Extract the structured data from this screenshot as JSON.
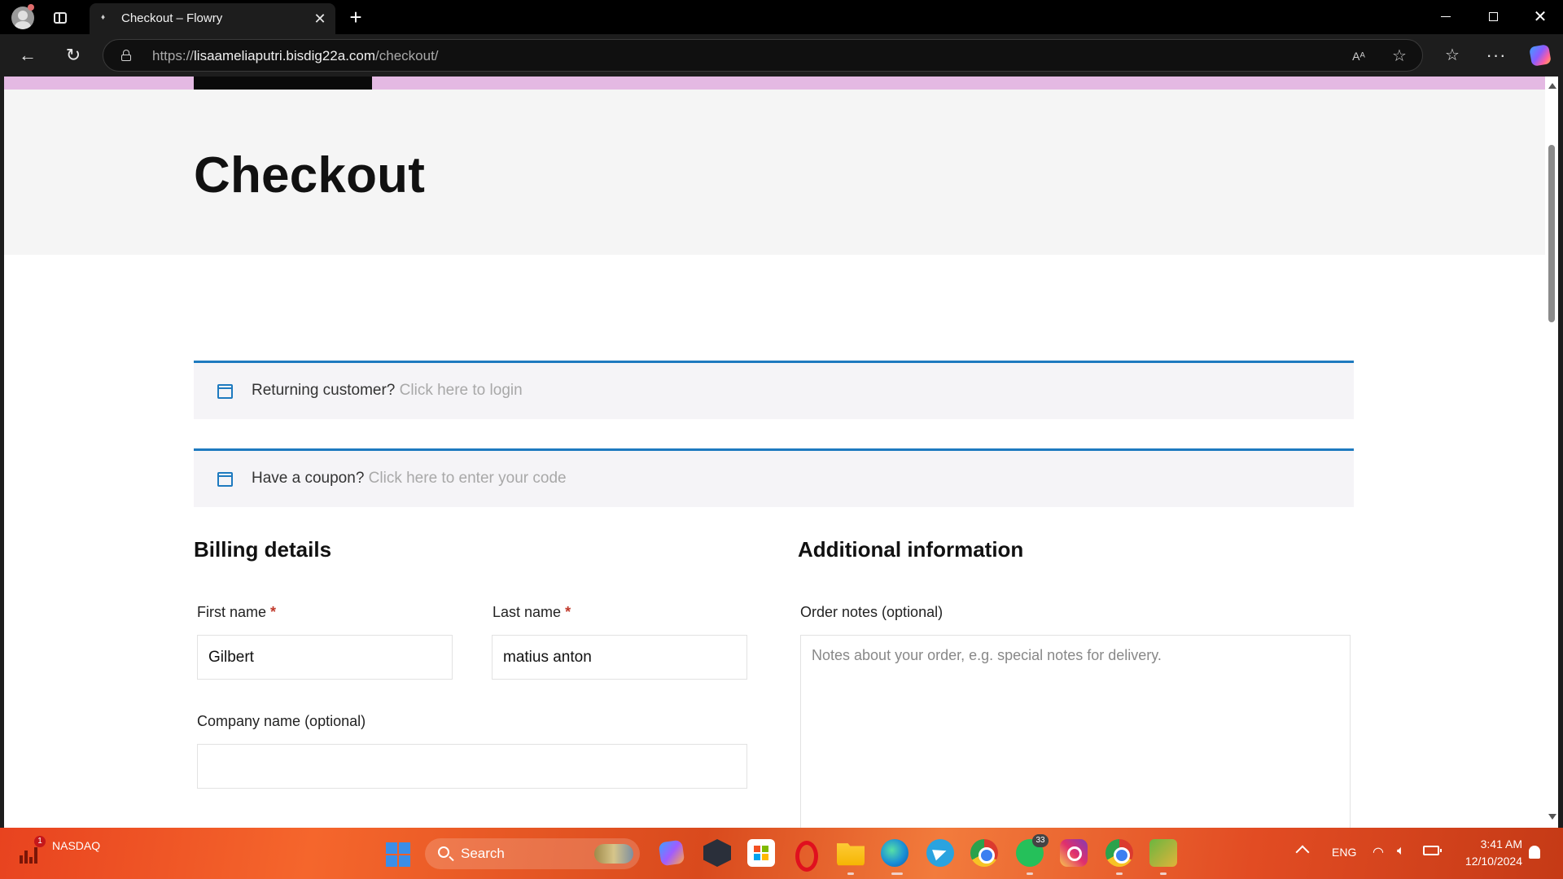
{
  "browser": {
    "tab_title": "Checkout – Flowry",
    "url_scheme": "https://",
    "url_host": "lisaameliaputri.bisdig22a.com",
    "url_path": "/checkout/"
  },
  "page": {
    "title": "Checkout",
    "notice_login_prefix": "Returning customer?",
    "notice_login_link": "Click here to login",
    "notice_coupon_prefix": "Have a coupon?",
    "notice_coupon_link": "Click here to enter your code",
    "billing_title": "Billing details",
    "additional_title": "Additional information",
    "accent_color": "#1e7abf",
    "stripe_color": "#e4b9e3"
  },
  "form": {
    "first_name_label": "First name",
    "first_name_value": "Gilbert",
    "last_name_label": "Last name",
    "last_name_value": "matius anton",
    "required_marker": "*",
    "company_label": "Company name (optional)",
    "company_value": "",
    "order_notes_label": "Order notes (optional)",
    "order_notes_placeholder": "Notes about your order, e.g. special notes for delivery."
  },
  "taskbar": {
    "widget_name": "NASDAQ",
    "widget_badge": "1",
    "search_label": "Search",
    "whatsapp_badge": "33",
    "language": "ENG",
    "time": "3:41 AM",
    "date": "12/10/2024"
  }
}
